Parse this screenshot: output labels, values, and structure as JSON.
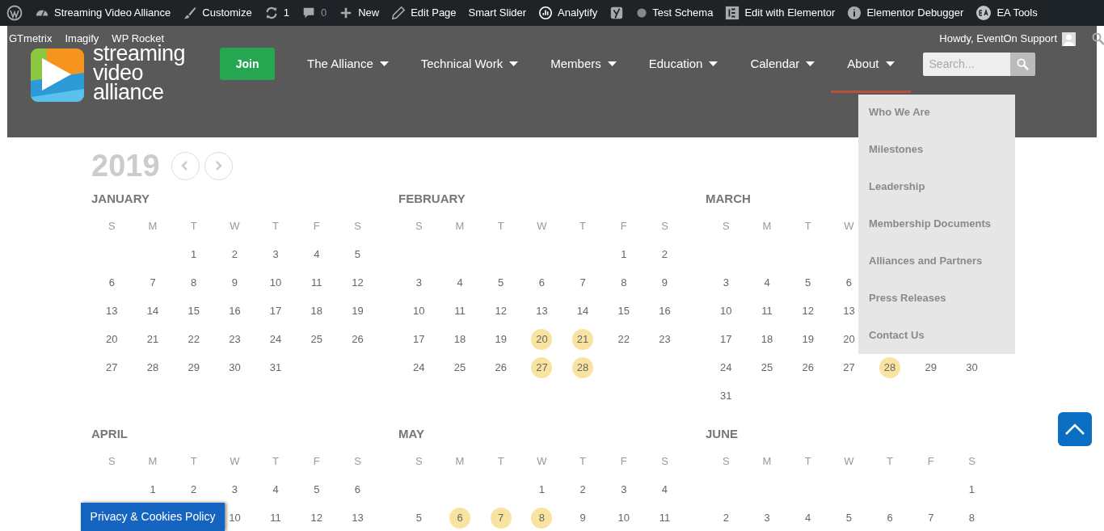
{
  "admin_bar": {
    "items": [
      {
        "kind": "wordpress"
      },
      {
        "kind": "dashboard",
        "label": "Streaming Video Alliance"
      },
      {
        "kind": "brush",
        "label": "Customize"
      },
      {
        "kind": "updates",
        "label": "1"
      },
      {
        "kind": "comments",
        "label": "0",
        "disabled": true
      },
      {
        "kind": "plus",
        "label": "New"
      },
      {
        "kind": "pencil",
        "label": "Edit Page"
      },
      {
        "kind": "text",
        "label": "Smart Slider"
      },
      {
        "kind": "analytics",
        "label": "Analytify"
      },
      {
        "kind": "yoast"
      },
      {
        "kind": "dot",
        "label": "Test Schema"
      },
      {
        "kind": "elementor",
        "label": "Edit with Elementor"
      },
      {
        "kind": "info",
        "label": "Elementor Debugger"
      },
      {
        "kind": "ea",
        "label": "EA Tools"
      }
    ],
    "second_row": [
      "GTmetrix",
      "Imagify",
      "WP Rocket"
    ],
    "account": "Howdy, EventOn Support"
  },
  "logo": {
    "lines": [
      "streaming",
      "video",
      "alliance"
    ]
  },
  "nav": {
    "join": "Join",
    "items": [
      {
        "label": "The Alliance",
        "selected": false
      },
      {
        "label": "Technical Work",
        "selected": false
      },
      {
        "label": "Members",
        "selected": false
      },
      {
        "label": "Education",
        "selected": false
      },
      {
        "label": "Calendar",
        "selected": false
      },
      {
        "label": "About",
        "selected": true
      }
    ],
    "search": {
      "placeholder": "Search..."
    }
  },
  "about_menu": [
    "Who We Are",
    "Milestones",
    "Leadership",
    "Membership Documents",
    "Alliances and Partners",
    "Press Releases",
    "Contact Us"
  ],
  "calendar": {
    "year": "2019",
    "months": [
      {
        "name": "JANUARY",
        "weekdays": [
          "S",
          "M",
          "T",
          "W",
          "T",
          "F",
          "S"
        ],
        "weeks": [
          [
            {
              "kind": "blank"
            },
            {
              "kind": "blank"
            },
            {
              "kind": "day",
              "day": "1",
              "event": false
            },
            {
              "kind": "day",
              "day": "2",
              "event": false
            },
            {
              "kind": "day",
              "day": "3",
              "event": false
            },
            {
              "kind": "day",
              "day": "4",
              "event": false
            },
            {
              "kind": "day",
              "day": "5",
              "event": false
            }
          ],
          [
            {
              "kind": "day",
              "day": "6",
              "event": false
            },
            {
              "kind": "day",
              "day": "7",
              "event": false
            },
            {
              "kind": "day",
              "day": "8",
              "event": false
            },
            {
              "kind": "day",
              "day": "9",
              "event": false
            },
            {
              "kind": "day",
              "day": "10",
              "event": false
            },
            {
              "kind": "day",
              "day": "11",
              "event": false
            },
            {
              "kind": "day",
              "day": "12",
              "event": false
            }
          ],
          [
            {
              "kind": "day",
              "day": "13",
              "event": false
            },
            {
              "kind": "day",
              "day": "14",
              "event": false
            },
            {
              "kind": "day",
              "day": "15",
              "event": false
            },
            {
              "kind": "day",
              "day": "16",
              "event": false
            },
            {
              "kind": "day",
              "day": "17",
              "event": false
            },
            {
              "kind": "day",
              "day": "18",
              "event": false
            },
            {
              "kind": "day",
              "day": "19",
              "event": false
            }
          ],
          [
            {
              "kind": "day",
              "day": "20",
              "event": false
            },
            {
              "kind": "day",
              "day": "21",
              "event": false
            },
            {
              "kind": "day",
              "day": "22",
              "event": false
            },
            {
              "kind": "day",
              "day": "23",
              "event": false
            },
            {
              "kind": "day",
              "day": "24",
              "event": false
            },
            {
              "kind": "day",
              "day": "25",
              "event": false
            },
            {
              "kind": "day",
              "day": "26",
              "event": false
            }
          ],
          [
            {
              "kind": "day",
              "day": "27",
              "event": false
            },
            {
              "kind": "day",
              "day": "28",
              "event": false
            },
            {
              "kind": "day",
              "day": "29",
              "event": false
            },
            {
              "kind": "day",
              "day": "30",
              "event": false
            },
            {
              "kind": "day",
              "day": "31",
              "event": false
            },
            {
              "kind": "blank"
            },
            {
              "kind": "blank"
            }
          ]
        ]
      },
      {
        "name": "FEBRUARY",
        "weekdays": [
          "S",
          "M",
          "T",
          "W",
          "T",
          "F",
          "S"
        ],
        "weeks": [
          [
            {
              "kind": "blank"
            },
            {
              "kind": "blank"
            },
            {
              "kind": "blank"
            },
            {
              "kind": "blank"
            },
            {
              "kind": "blank"
            },
            {
              "kind": "day",
              "day": "1",
              "event": false
            },
            {
              "kind": "day",
              "day": "2",
              "event": false
            }
          ],
          [
            {
              "kind": "day",
              "day": "3",
              "event": false
            },
            {
              "kind": "day",
              "day": "4",
              "event": false
            },
            {
              "kind": "day",
              "day": "5",
              "event": false
            },
            {
              "kind": "day",
              "day": "6",
              "event": false
            },
            {
              "kind": "day",
              "day": "7",
              "event": false
            },
            {
              "kind": "day",
              "day": "8",
              "event": false
            },
            {
              "kind": "day",
              "day": "9",
              "event": false
            }
          ],
          [
            {
              "kind": "day",
              "day": "10",
              "event": false
            },
            {
              "kind": "day",
              "day": "11",
              "event": false
            },
            {
              "kind": "day",
              "day": "12",
              "event": false
            },
            {
              "kind": "day",
              "day": "13",
              "event": false
            },
            {
              "kind": "day",
              "day": "14",
              "event": false
            },
            {
              "kind": "day",
              "day": "15",
              "event": false
            },
            {
              "kind": "day",
              "day": "16",
              "event": false
            }
          ],
          [
            {
              "kind": "day",
              "day": "17",
              "event": false
            },
            {
              "kind": "day",
              "day": "18",
              "event": false
            },
            {
              "kind": "day",
              "day": "19",
              "event": false
            },
            {
              "kind": "day",
              "day": "20",
              "event": true
            },
            {
              "kind": "day",
              "day": "21",
              "event": true
            },
            {
              "kind": "day",
              "day": "22",
              "event": false
            },
            {
              "kind": "day",
              "day": "23",
              "event": false
            }
          ],
          [
            {
              "kind": "day",
              "day": "24",
              "event": false
            },
            {
              "kind": "day",
              "day": "25",
              "event": false
            },
            {
              "kind": "day",
              "day": "26",
              "event": false
            },
            {
              "kind": "day",
              "day": "27",
              "event": true
            },
            {
              "kind": "day",
              "day": "28",
              "event": true
            },
            {
              "kind": "blank"
            },
            {
              "kind": "blank"
            }
          ]
        ]
      },
      {
        "name": "MARCH",
        "weekdays": [
          "S",
          "M",
          "T",
          "W"
        ],
        "weeks": [
          [
            {
              "kind": "blank"
            },
            {
              "kind": "blank"
            },
            {
              "kind": "blank"
            },
            {
              "kind": "blank"
            },
            {
              "kind": "blank"
            },
            {
              "kind": "blank"
            },
            {
              "kind": "blank"
            }
          ],
          [
            {
              "kind": "day",
              "day": "3",
              "event": false
            },
            {
              "kind": "day",
              "day": "4",
              "event": false
            },
            {
              "kind": "day",
              "day": "5",
              "event": false
            },
            {
              "kind": "day",
              "day": "6",
              "event": false
            },
            {
              "kind": "blank"
            },
            {
              "kind": "blank"
            },
            {
              "kind": "blank"
            }
          ],
          [
            {
              "kind": "day",
              "day": "10",
              "event": false
            },
            {
              "kind": "day",
              "day": "11",
              "event": false
            },
            {
              "kind": "day",
              "day": "12",
              "event": false
            },
            {
              "kind": "day",
              "day": "13",
              "event": false
            },
            {
              "kind": "blank"
            },
            {
              "kind": "blank"
            },
            {
              "kind": "blank"
            }
          ],
          [
            {
              "kind": "day",
              "day": "17",
              "event": false
            },
            {
              "kind": "day",
              "day": "18",
              "event": false
            },
            {
              "kind": "day",
              "day": "19",
              "event": false
            },
            {
              "kind": "day",
              "day": "20",
              "event": false
            },
            {
              "kind": "blank"
            },
            {
              "kind": "blank"
            },
            {
              "kind": "blank"
            }
          ],
          [
            {
              "kind": "day",
              "day": "24",
              "event": false
            },
            {
              "kind": "day",
              "day": "25",
              "event": false
            },
            {
              "kind": "day",
              "day": "26",
              "event": false
            },
            {
              "kind": "day",
              "day": "27",
              "event": false
            },
            {
              "kind": "day",
              "day": "28",
              "event": true
            },
            {
              "kind": "day",
              "day": "29",
              "event": false
            },
            {
              "kind": "day",
              "day": "30",
              "event": false
            }
          ],
          [
            {
              "kind": "day",
              "day": "31",
              "event": false
            },
            {
              "kind": "blank"
            },
            {
              "kind": "blank"
            },
            {
              "kind": "blank"
            },
            {
              "kind": "blank"
            },
            {
              "kind": "blank"
            },
            {
              "kind": "blank"
            }
          ]
        ]
      },
      {
        "name": "APRIL",
        "weekdays": [
          "S",
          "M",
          "T",
          "W",
          "T",
          "F",
          "S"
        ],
        "weeks": [
          [
            {
              "kind": "blank"
            },
            {
              "kind": "day",
              "day": "1",
              "event": false
            },
            {
              "kind": "day",
              "day": "2",
              "event": false
            },
            {
              "kind": "day",
              "day": "3",
              "event": false
            },
            {
              "kind": "day",
              "day": "4",
              "event": false
            },
            {
              "kind": "day",
              "day": "5",
              "event": false
            },
            {
              "kind": "day",
              "day": "6",
              "event": false
            }
          ],
          [
            {
              "kind": "blank"
            },
            {
              "kind": "blank"
            },
            {
              "kind": "blank"
            },
            {
              "kind": "day",
              "day": "10",
              "event": false
            },
            {
              "kind": "day",
              "day": "11",
              "event": false
            },
            {
              "kind": "day",
              "day": "12",
              "event": false
            },
            {
              "kind": "day",
              "day": "13",
              "event": false
            }
          ]
        ]
      },
      {
        "name": "MAY",
        "weekdays": [
          "S",
          "M",
          "T",
          "W",
          "T",
          "F",
          "S"
        ],
        "weeks": [
          [
            {
              "kind": "blank"
            },
            {
              "kind": "blank"
            },
            {
              "kind": "blank"
            },
            {
              "kind": "day",
              "day": "1",
              "event": false
            },
            {
              "kind": "day",
              "day": "2",
              "event": false
            },
            {
              "kind": "day",
              "day": "3",
              "event": false
            },
            {
              "kind": "day",
              "day": "4",
              "event": false
            }
          ],
          [
            {
              "kind": "day",
              "day": "5",
              "event": false
            },
            {
              "kind": "day",
              "day": "6",
              "event": true
            },
            {
              "kind": "day",
              "day": "7",
              "event": true
            },
            {
              "kind": "day",
              "day": "8",
              "event": true
            },
            {
              "kind": "day",
              "day": "9",
              "event": false
            },
            {
              "kind": "day",
              "day": "10",
              "event": false
            },
            {
              "kind": "day",
              "day": "11",
              "event": false
            }
          ]
        ]
      },
      {
        "name": "JUNE",
        "weekdays": [
          "S",
          "M",
          "T",
          "W",
          "T",
          "F",
          "S"
        ],
        "weeks": [
          [
            {
              "kind": "blank"
            },
            {
              "kind": "blank"
            },
            {
              "kind": "blank"
            },
            {
              "kind": "blank"
            },
            {
              "kind": "blank"
            },
            {
              "kind": "blank"
            },
            {
              "kind": "day",
              "day": "1",
              "event": false
            }
          ],
          [
            {
              "kind": "day",
              "day": "2",
              "event": false
            },
            {
              "kind": "day",
              "day": "3",
              "event": false
            },
            {
              "kind": "day",
              "day": "4",
              "event": false
            },
            {
              "kind": "day",
              "day": "5",
              "event": false
            },
            {
              "kind": "day",
              "day": "6",
              "event": false
            },
            {
              "kind": "day",
              "day": "7",
              "event": false
            },
            {
              "kind": "day",
              "day": "8",
              "event": false
            }
          ]
        ]
      }
    ]
  },
  "privacy_button": "Privacy & Cookies Policy"
}
